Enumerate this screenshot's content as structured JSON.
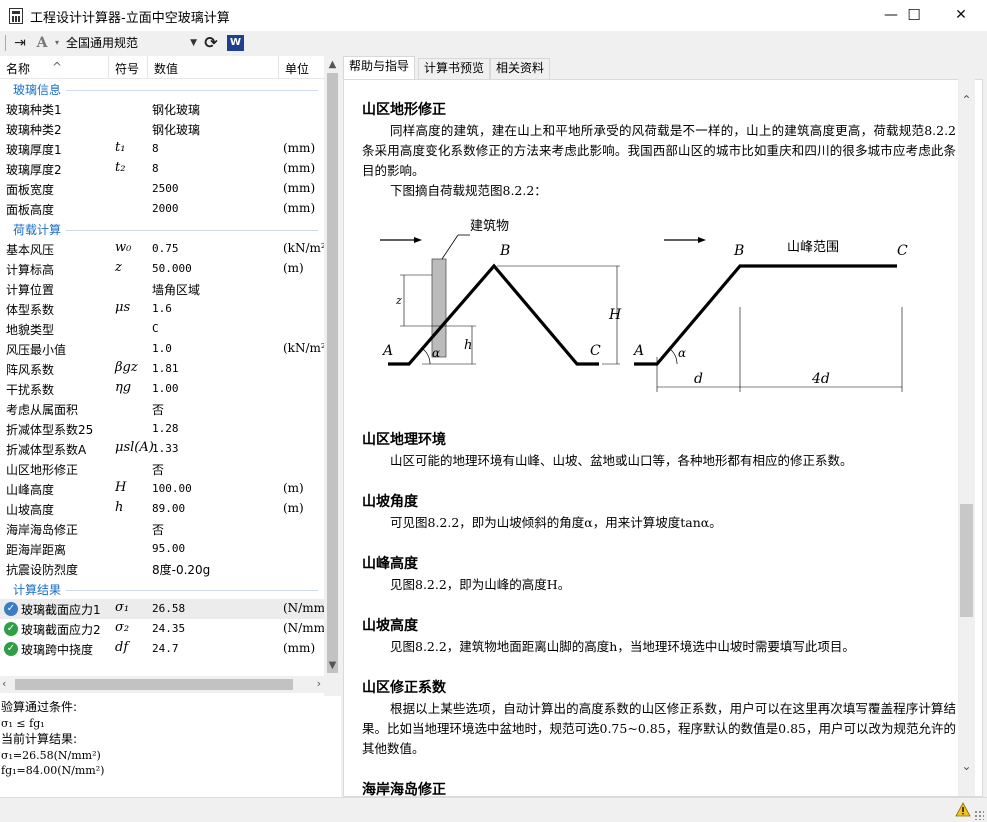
{
  "window": {
    "title": "工程设计计算器-立面中空玻璃计算",
    "minimize": "—",
    "maximize": "☐",
    "close": "✕"
  },
  "toolbar": {
    "standard": "全国通用规范",
    "icons": [
      "exit-icon",
      "font-style-icon",
      "refresh-icon",
      "word-export-icon"
    ]
  },
  "columns": {
    "name": "名称",
    "symbol": "符号",
    "value": "数值",
    "unit": "单位"
  },
  "groups": {
    "glass": "玻璃信息",
    "load": "荷载计算",
    "result": "计算结果"
  },
  "glass_rows": [
    {
      "name": "玻璃种类1",
      "symbol": "",
      "value": "钢化玻璃",
      "unit": ""
    },
    {
      "name": "玻璃种类2",
      "symbol": "",
      "value": "钢化玻璃",
      "unit": ""
    },
    {
      "name": "玻璃厚度1",
      "symbol": "t₁",
      "value": "8",
      "unit": "(mm)"
    },
    {
      "name": "玻璃厚度2",
      "symbol": "t₂",
      "value": "8",
      "unit": "(mm)"
    },
    {
      "name": "面板宽度",
      "symbol": "",
      "value": "2500",
      "unit": "(mm)"
    },
    {
      "name": "面板高度",
      "symbol": "",
      "value": "2000",
      "unit": "(mm)"
    }
  ],
  "load_rows": [
    {
      "name": "基本风压",
      "symbol": "w₀",
      "value": "0.75",
      "unit": "(kN/m²)"
    },
    {
      "name": "计算标高",
      "symbol": "z",
      "value": "50.000",
      "unit": "(m)"
    },
    {
      "name": "计算位置",
      "symbol": "",
      "value": "墙角区域",
      "unit": ""
    },
    {
      "name": "体型系数",
      "symbol": "μs",
      "value": "1.6",
      "unit": ""
    },
    {
      "name": "地貌类型",
      "symbol": "",
      "value": "C",
      "unit": ""
    },
    {
      "name": "风压最小值",
      "symbol": "",
      "value": "1.0",
      "unit": "(kN/m²)"
    },
    {
      "name": "阵风系数",
      "symbol": "βgz",
      "value": "1.81",
      "unit": ""
    },
    {
      "name": "干扰系数",
      "symbol": "ηg",
      "value": "1.00",
      "unit": ""
    },
    {
      "name": "考虑从属面积",
      "symbol": "",
      "value": "否",
      "unit": ""
    },
    {
      "name": "折减体型系数25",
      "symbol": "",
      "value": "1.28",
      "unit": ""
    },
    {
      "name": "折减体型系数A",
      "symbol": "μsl(A)",
      "value": "1.33",
      "unit": ""
    },
    {
      "name": "山区地形修正",
      "symbol": "",
      "value": "否",
      "unit": ""
    },
    {
      "name": "山峰高度",
      "symbol": "H",
      "value": "100.00",
      "unit": "(m)"
    },
    {
      "name": "山坡高度",
      "symbol": "h",
      "value": "89.00",
      "unit": "(m)"
    },
    {
      "name": "海岸海岛修正",
      "symbol": "",
      "value": "否",
      "unit": ""
    },
    {
      "name": "距海岸距离",
      "symbol": "",
      "value": "95.00",
      "unit": ""
    },
    {
      "name": "抗震设防烈度",
      "symbol": "",
      "value": "8度-0.20g",
      "unit": ""
    }
  ],
  "result_rows": [
    {
      "name": "玻璃截面应力1",
      "symbol": "σ₁",
      "value": "26.58",
      "unit": "(N/mm²)"
    },
    {
      "name": "玻璃截面应力2",
      "symbol": "σ₂",
      "value": "24.35",
      "unit": "(N/mm²)"
    },
    {
      "name": "玻璃跨中挠度",
      "symbol": "df",
      "value": "24.7",
      "unit": "(mm)"
    }
  ],
  "info": {
    "pass_label": "验算通过条件:",
    "pass_condition": "σ₁ ≤ fg₁",
    "current_label": "当前计算结果:",
    "current_sigma": "σ₁=26.58(N/mm²)",
    "current_fg": "fg₁=84.00(N/mm²)"
  },
  "tabs": [
    "帮助与指导",
    "计算书预览",
    "相关资料"
  ],
  "help": {
    "s1_title": "山区地形修正",
    "s1_p1": "同样高度的建筑，建在山上和平地所承受的风荷载是不一样的，山上的建筑高度更高，荷载规范8.2.2条采用高度变化系数修正的方法来考虑此影响。我国西部山区的城市比如重庆和四川的很多城市应考虑此条目的影响。",
    "s1_p2": "下图摘自荷载规范图8.2.2：",
    "s2_title": "山区地理环境",
    "s2_p": "山区可能的地理环境有山峰、山坡、盆地或山口等，各种地形都有相应的修正系数。",
    "s3_title": "山坡角度",
    "s3_p": "可见图8.2.2，即为山坡倾斜的角度α，用来计算坡度tanα。",
    "s4_title": "山峰高度",
    "s4_p": "见图8.2.2，即为山峰的高度H。",
    "s5_title": "山坡高度",
    "s5_p": "见图8.2.2，建筑物地面距离山脚的高度h，当地理环境选中山坡时需要填写此项目。",
    "s6_title": "山区修正系数",
    "s6_p": "根据以上某些选项，自动计算出的高度系数的山区修正系数，用户可以在这里再次填写覆盖程序计算结果。比如当地理环境选中盆地时，规范可选0.75~0.85，程序默认的数值是0.85，用户可以改为规范允许的其他数值。",
    "s7_title": "海岸海岛修正"
  },
  "figure": {
    "building_label": "建筑物",
    "range_label": "山峰范围",
    "A": "A",
    "B": "B",
    "C": "C",
    "H": "H",
    "h": "h",
    "z": "z",
    "alpha": "α",
    "d": "d",
    "d4": "4d"
  },
  "colors": {
    "group_text": "#1a6fc9",
    "check_green": "#2f9e44",
    "check_blue": "#3a7cc6"
  }
}
